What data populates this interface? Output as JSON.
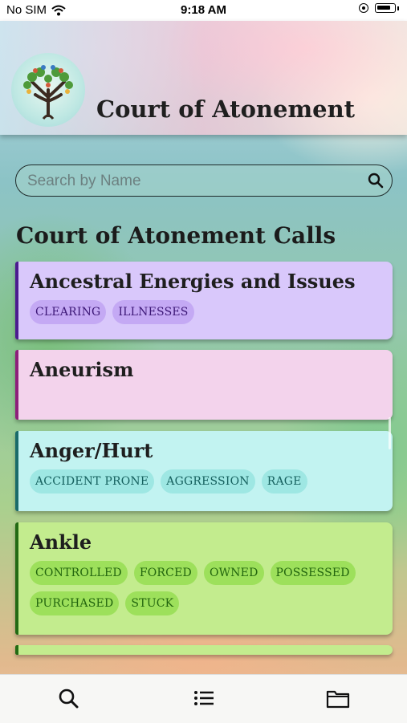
{
  "status_bar": {
    "carrier": "No SIM",
    "time": "9:18 AM"
  },
  "header": {
    "title": "Court of Atonement",
    "logo_icon": "tree-of-life-heart-logo"
  },
  "search": {
    "placeholder": "Search by Name",
    "value": ""
  },
  "section": {
    "title": "Court of Atonement Calls"
  },
  "cards": [
    {
      "title": "Ancestral Energies and Issues",
      "bg": "#d9c8fb",
      "accent": "#4b1b8f",
      "tag_bg": "#c4a9f4",
      "tag_color": "#3d1877",
      "tags": [
        "CLEARING",
        "ILLNESSES"
      ]
    },
    {
      "title": "Aneurism",
      "bg": "#f3d3ec",
      "accent": "#8d1f7a",
      "tag_bg": "#e8b9df",
      "tag_color": "#6d1660",
      "tags": []
    },
    {
      "title": "Anger/Hurt",
      "bg": "#c2f3f1",
      "accent": "#1a6b6a",
      "tag_bg": "#9ee7e3",
      "tag_color": "#15605e",
      "tags": [
        "ACCIDENT PRONE",
        "AGGRESSION",
        "RAGE"
      ]
    },
    {
      "title": "Ankle",
      "bg": "#c3ec8e",
      "accent": "#236a14",
      "tag_bg": "#9de05b",
      "tag_color": "#22650e",
      "tags": [
        "CONTROLLED",
        "FORCED",
        "OWNED",
        "POSSESSED",
        "PURCHASED",
        "STUCK"
      ]
    },
    {
      "title": "",
      "bg": "#c3ec8e",
      "accent": "#236a14",
      "tag_bg": "#9de05b",
      "tag_color": "#22650e",
      "tags": []
    }
  ],
  "tabbar": {
    "items": [
      "search-icon",
      "list-icon",
      "folder-icon"
    ]
  }
}
